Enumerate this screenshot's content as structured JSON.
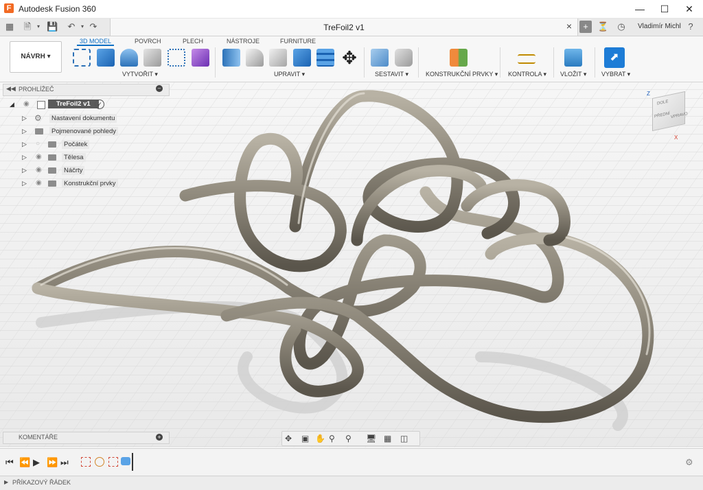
{
  "window": {
    "title": "Autodesk Fusion 360",
    "logo": "F"
  },
  "document": {
    "tab_title": "TreFoil2 v1",
    "user": "Vladimír Michl"
  },
  "toolbar": {
    "design_button": "NÁVRH ▾",
    "tabs": [
      "3D MODEL",
      "POVRCH",
      "PLECH",
      "NÁSTROJE",
      "FURNITURE"
    ],
    "active_tab": "3D MODEL",
    "groups": [
      "VYTVOŘIT ▾",
      "UPRAVIT ▾",
      "SESTAVIT ▾",
      "KONSTRUKČNÍ PRVKY ▾",
      "KONTROLA ▾",
      "VLOŽIT ▾",
      "VYBRAT ▾"
    ]
  },
  "browser": {
    "title": "PROHLÍŽEČ",
    "root": "TreFoil2 v1",
    "items": [
      "Nastavení dokumentu",
      "Pojmenované pohledy",
      "Počátek",
      "Tělesa",
      "Náčrty",
      "Konstrukční prvky"
    ]
  },
  "comments": {
    "title": "KOMENTÁŘE"
  },
  "viewcube": {
    "faces": [
      "DOLE",
      "PŘEDNÍ",
      "VPRAVO"
    ],
    "axes": [
      "Z",
      "X"
    ]
  },
  "command_line": {
    "label": "PŘÍKAZOVÝ ŘÁDEK"
  },
  "colors": {
    "accent": "#0d6fc4",
    "knot": "#8b8578",
    "logo": "#f26a23"
  }
}
